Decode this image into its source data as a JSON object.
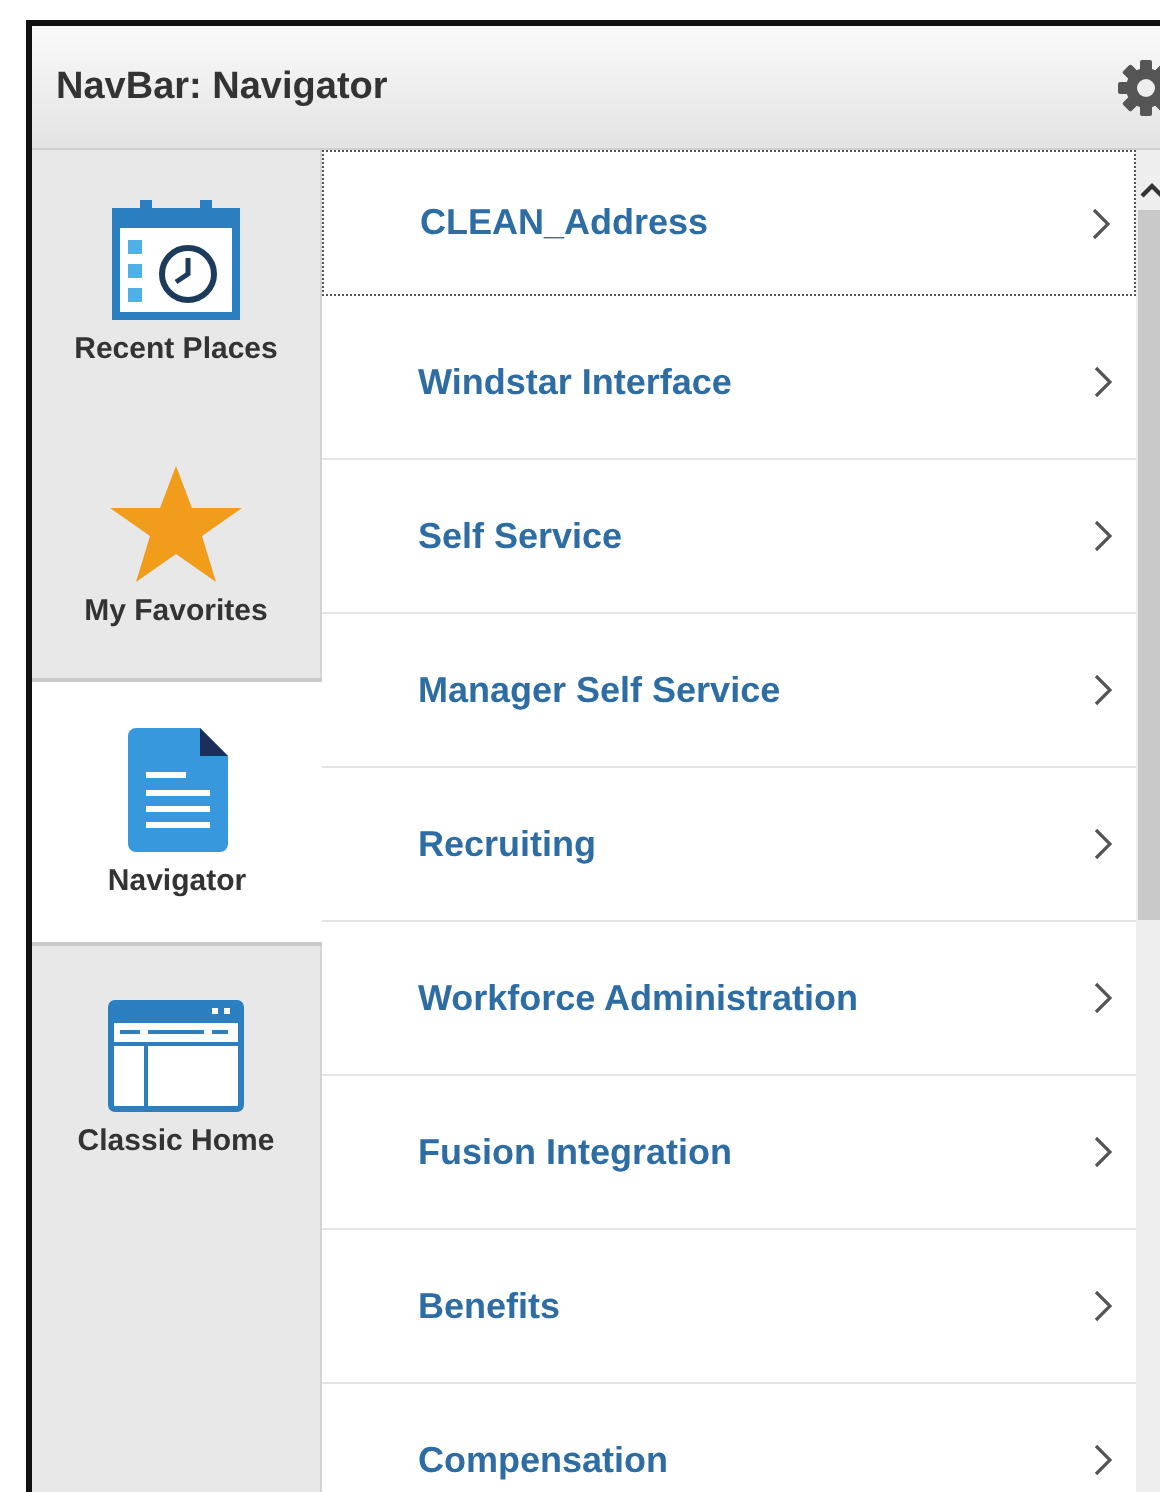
{
  "header": {
    "title": "NavBar: Navigator"
  },
  "sidebar": {
    "items": [
      {
        "label": "Recent Places",
        "kind": "recent",
        "selected": false
      },
      {
        "label": "My Favorites",
        "kind": "favorites",
        "selected": false
      },
      {
        "label": "Navigator",
        "kind": "navigator",
        "selected": true
      },
      {
        "label": "Classic Home",
        "kind": "classic",
        "selected": false
      }
    ]
  },
  "menu": {
    "items": [
      {
        "label": "CLEAN_Address",
        "focused": true
      },
      {
        "label": "Windstar Interface",
        "focused": false
      },
      {
        "label": "Self Service",
        "focused": false
      },
      {
        "label": "Manager Self Service",
        "focused": false
      },
      {
        "label": "Recruiting",
        "focused": false
      },
      {
        "label": "Workforce Administration",
        "focused": false
      },
      {
        "label": "Fusion Integration",
        "focused": false
      },
      {
        "label": "Benefits",
        "focused": false
      },
      {
        "label": "Compensation",
        "focused": false
      }
    ]
  }
}
